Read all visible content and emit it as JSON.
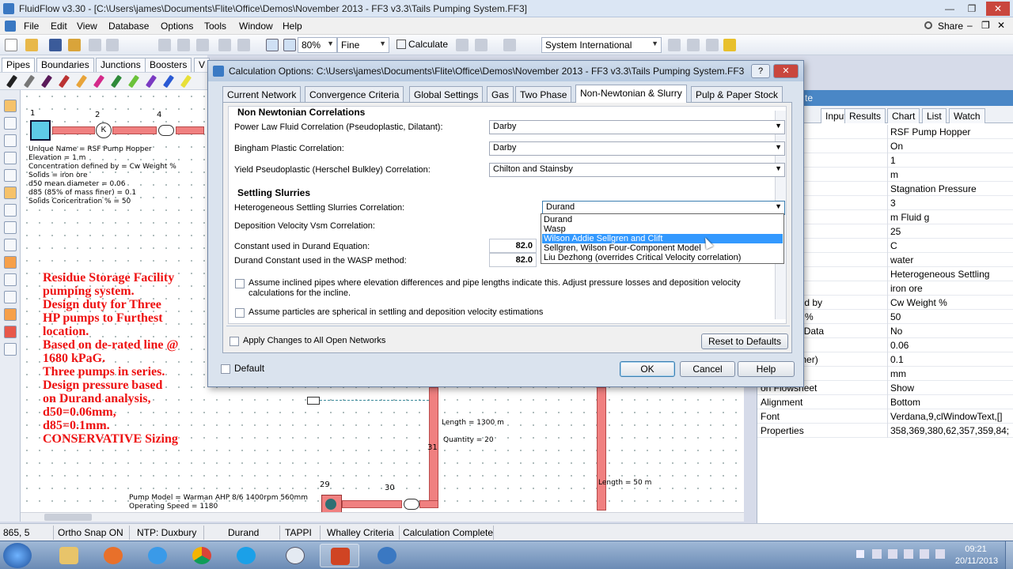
{
  "window": {
    "title": "FluidFlow v3.30 - [C:\\Users\\james\\Documents\\Flite\\Office\\Demos\\November 2013 - FF3 v3.3\\Tails Pumping System.FF3]",
    "minimize": "—",
    "restore": "❐",
    "close": "✕"
  },
  "menu": [
    "File",
    "Edit",
    "View",
    "Database",
    "Options",
    "Tools",
    "Window",
    "Help"
  ],
  "share_label": "Share",
  "toolbar": {
    "zoom": "80%",
    "quality": "Fine",
    "calculate": "Calculate",
    "units": "System International"
  },
  "component_tabs": [
    "Pipes",
    "Boundaries",
    "Junctions",
    "Boosters",
    "V"
  ],
  "canvas": {
    "node_labels": [
      "1",
      "2",
      "4",
      "29",
      "30",
      "31"
    ],
    "info_block": [
      "Unique Name = RSF Pump Hopper",
      "Elevation = 1 m",
      "Concentration defined by = Cw Weight %",
      "Solids = iron ore",
      "d50 mean diameter = 0.06",
      "d85 (85% of mass finer) = 0.1",
      "Solids Concentration % = 50"
    ],
    "notes": [
      "Residue Storage Facility",
      "pumping system.",
      "Design duty for Three",
      "HP pumps to Furthest",
      "location.",
      "Based on de-rated line @",
      "1680 kPaG.",
      "Three pumps in series.",
      "Design pressure based",
      "on Durand analysis,",
      "d50=0.06mm,",
      "d85=0.1mm.",
      "CONSERVATIVE Sizing"
    ],
    "length_1": "Length = 1300 m",
    "quantity": "Quantity = 20",
    "length_2": "Length = 50 m",
    "pump_model": "Pump Model = Warman AHP 8/6 1400rpm 560mm",
    "operating_speed": "Operating Speed = 1180",
    "pump_k": "K"
  },
  "right_panel": {
    "header": "te",
    "tabs": [
      "Input",
      "Results",
      "Chart",
      "List",
      "Watch"
    ],
    "properties": [
      {
        "name": "me",
        "value": "RSF Pump Hopper"
      },
      {
        "name": "",
        "value": "On"
      },
      {
        "name": "",
        "value": "1"
      },
      {
        "name": "Unit",
        "value": "m"
      },
      {
        "name": "odel",
        "value": "Stagnation Pressure"
      },
      {
        "name": "",
        "value": "3"
      },
      {
        "name": "nit",
        "value": "m Fluid g"
      },
      {
        "name": "re",
        "value": "25"
      },
      {
        "name": "re Unit",
        "value": "C"
      },
      {
        "name": "",
        "value": "water"
      },
      {
        "name": "",
        "value": "Heterogeneous Settling"
      },
      {
        "name": "",
        "value": "iron ore"
      },
      {
        "name": "tion defined by",
        "value": "Cw Weight %"
      },
      {
        "name": "centration %",
        "value": "50"
      },
      {
        "name": "istribution Data",
        "value": "No"
      },
      {
        "name": "diameter",
        "value": "0.06"
      },
      {
        "name": "of mass finer)",
        "value": "0.1"
      },
      {
        "name": "ze Unit",
        "value": "mm"
      },
      {
        "name": "on Flowsheet",
        "value": "Show"
      },
      {
        "name": "Alignment",
        "value": "Bottom"
      },
      {
        "name": "Font",
        "value": "Verdana,9,clWindowText,[]"
      },
      {
        "name": "Properties",
        "value": "358,369,380,62,357,359,84;"
      }
    ]
  },
  "dialog": {
    "title": "Calculation Options: C:\\Users\\james\\Documents\\Flite\\Office\\Demos\\November 2013 - FF3 v3.3\\Tails Pumping System.FF3",
    "help_btn": "?",
    "close_btn": "✕",
    "tabs": [
      "Current Network",
      "Convergence Criteria",
      "Global Settings",
      "Gas",
      "Two Phase",
      "Non-Newtonian & Slurry",
      "Pulp & Paper Stock"
    ],
    "active_tab": "Non-Newtonian & Slurry",
    "sections": {
      "non_newtonian": "Non Newtonian Correlations",
      "settling": "Settling Slurries"
    },
    "fields": {
      "power_law_label": "Power Law Fluid Correlation (Pseudoplastic, Dilatant):",
      "power_law_value": "Darby",
      "bingham_label": "Bingham Plastic Correlation:",
      "bingham_value": "Darby",
      "yield_label": "Yield Pseudoplastic (Herschel Bulkley) Correlation:",
      "yield_value": "Chilton and Stainsby",
      "hetero_label": "Heterogeneous Settling Slurries Correlation:",
      "hetero_value": "Durand",
      "deposition_label": "Deposition Velocity Vsm Correlation:",
      "durand_const_label": "Constant used in Durand Equation:",
      "durand_const_value": "82.0",
      "wasp_const_label": "Durand Constant used in the WASP method:",
      "wasp_const_value": "82.0"
    },
    "checkboxes": {
      "inclined": "Assume inclined pipes where elevation differences and pipe lengths indicate this. Adjust pressure losses and deposition velocity calculations for the incline.",
      "spherical": "Assume particles are spherical in settling and deposition velocity estimations",
      "apply_all": "Apply Changes to All Open Networks",
      "default": "Default"
    },
    "buttons": {
      "reset": "Reset to Defaults",
      "ok": "OK",
      "cancel": "Cancel",
      "help": "Help"
    },
    "dropdown_options": [
      "Durand",
      "Wasp",
      "Wilson Addie Sellgren and Clift",
      "Sellgren, Wilson Four-Component Model",
      "Liu Dezhong (overrides Critical Velocity correlation)"
    ],
    "dropdown_selected_index": 2
  },
  "status_bar": [
    "865, 5",
    "Ortho Snap ON",
    "NTP: Duxbury",
    "Durand",
    "TAPPI",
    "Whalley Criteria",
    "Calculation Complete"
  ],
  "clock": {
    "time": "09:21",
    "date": "20/11/2013"
  }
}
